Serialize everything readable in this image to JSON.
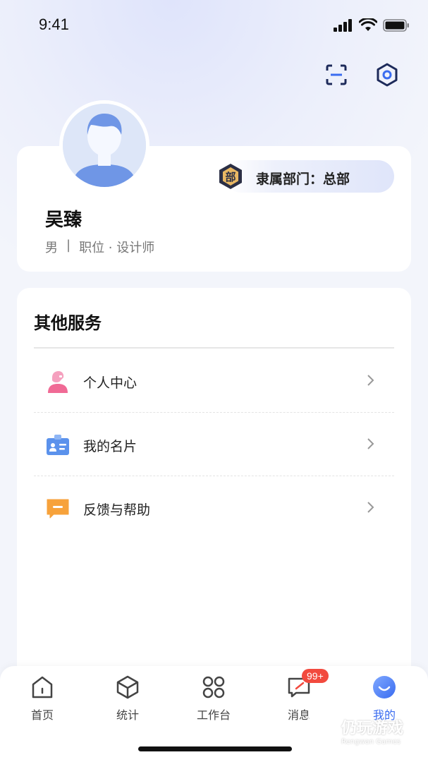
{
  "status_bar": {
    "time": "9:41"
  },
  "top_actions": {
    "scan_icon": "scan-icon",
    "settings_icon": "settings-hex-icon"
  },
  "profile": {
    "department": "隶属部门：总部",
    "name": "吴臻",
    "gender": "男",
    "separator": "|",
    "position": "职位 · 设计师"
  },
  "services": {
    "title": "其他服务",
    "items": [
      {
        "label": "个人中心",
        "icon": "person-center-icon"
      },
      {
        "label": "我的名片",
        "icon": "business-card-icon"
      },
      {
        "label": "反馈与帮助",
        "icon": "feedback-icon"
      }
    ]
  },
  "tabbar": {
    "tabs": [
      {
        "label": "首页",
        "icon": "home-icon"
      },
      {
        "label": "统计",
        "icon": "stats-cube-icon"
      },
      {
        "label": "工作台",
        "icon": "workbench-icon"
      },
      {
        "label": "消息",
        "icon": "message-icon",
        "badge": "99+"
      },
      {
        "label": "我的",
        "icon": "profile-smile-icon",
        "active": true
      }
    ]
  },
  "watermark": {
    "text": "仍玩游戏",
    "sub": "Rengwan Games"
  },
  "colors": {
    "accent": "#3a6cf0",
    "badge": "#f24a3e",
    "background": "#f3f5fb"
  }
}
